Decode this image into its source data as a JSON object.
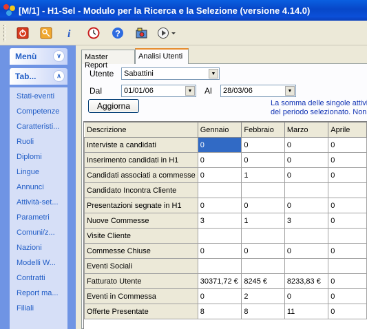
{
  "window": {
    "title": "[M/1] - H1-Sel - Modulo per la Ricerca e la Selezione (versione 4.14.0)"
  },
  "toolbar": {
    "icons": [
      "power-icon",
      "key-icon",
      "info-icon",
      "clock-icon",
      "help-icon",
      "photo-icon",
      "play-dropdown-icon"
    ]
  },
  "sidebar": {
    "menu_label": "Menù",
    "tab_label": "Tab...",
    "items": [
      "Stati-eventi",
      "Competenze",
      "Caratteristi...",
      "Ruoli",
      "Diplomi",
      "Lingue",
      "Annunci",
      "Attività-set...",
      "Parametri",
      "Comuni/z...",
      "Nazioni",
      "Modelli W...",
      "Contratti",
      "Report ma...",
      "Filiali"
    ]
  },
  "tabs": [
    "Master Report",
    "Analisi Utenti"
  ],
  "active_tab": "Analisi Utenti",
  "filters": {
    "utente_label": "Utente",
    "utente_value": "Sabattini",
    "dal_label": "Dal",
    "dal_value": "01/01/06",
    "al_label": "Al",
    "al_value": "28/03/06",
    "update_button": "Aggiorna",
    "info_line1": "La somma delle singole attivit",
    "info_line2": "del periodo selezionato. Non s"
  },
  "grid": {
    "columns": [
      "Descrizione",
      "Gennaio",
      "Febbraio",
      "Marzo",
      "Aprile"
    ],
    "rows": [
      [
        "Interviste a candidati",
        "0",
        "0",
        "0",
        "0"
      ],
      [
        "Inserimento candidati in H1",
        "0",
        "0",
        "0",
        "0"
      ],
      [
        "Candidati associati a commesse",
        "0",
        "1",
        "0",
        "0"
      ],
      [
        "Candidato Incontra Cliente",
        "",
        "",
        "",
        ""
      ],
      [
        "Presentazioni segnate in H1",
        "0",
        "0",
        "0",
        "0"
      ],
      [
        "Nuove Commesse",
        "3",
        "1",
        "3",
        "0"
      ],
      [
        "Visite Cliente",
        "",
        "",
        "",
        ""
      ],
      [
        "Commesse Chiuse",
        "0",
        "0",
        "0",
        "0"
      ],
      [
        "Eventi Sociali",
        "",
        "",
        "",
        ""
      ],
      [
        "Fatturato Utente",
        "30371,72 €",
        "8245 €",
        "8233,83 €",
        "0"
      ],
      [
        "Eventi in Commessa",
        "0",
        "2",
        "0",
        "0"
      ],
      [
        "Offerte Presentate",
        "8",
        "8",
        "11",
        "0"
      ]
    ]
  },
  "colors": {
    "title_bar": "#0a5fe0",
    "sidebar_bg": "#6f94e4",
    "sidebar_link": "#215dc6",
    "selected_cell": "#316ac5",
    "active_tab_accent": "#e68b2c",
    "info_text": "#1234b4"
  }
}
